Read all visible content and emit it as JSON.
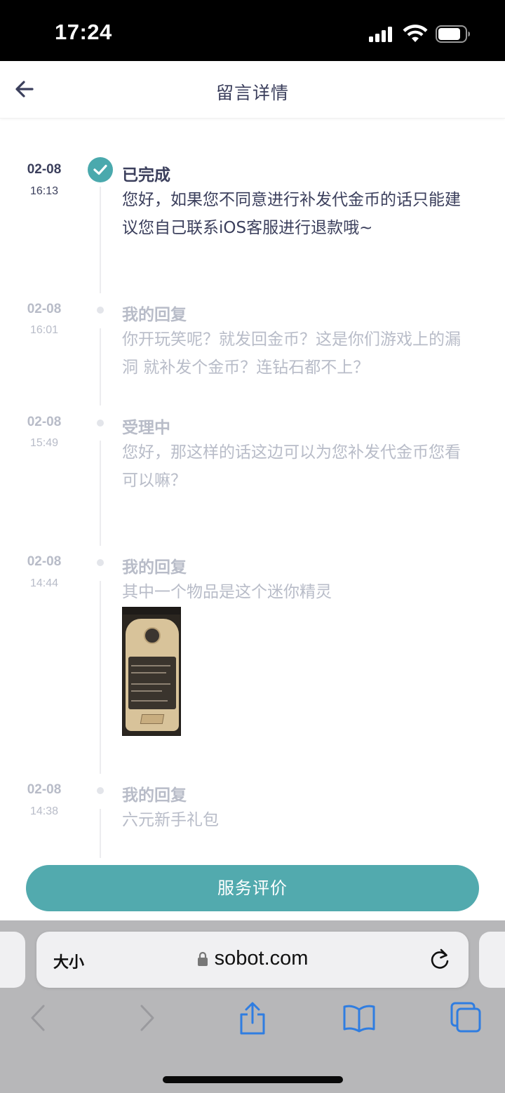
{
  "status_bar": {
    "time": "17:24"
  },
  "header": {
    "title": "留言详情",
    "back_icon": "arrow-left-icon"
  },
  "timeline": [
    {
      "date": "02-08",
      "time": "16:13",
      "title": "已完成",
      "text": "您好，如果您不同意进行补发代金币的话只能建议您自己联系iOS客服进行退款哦~",
      "status": "completed"
    },
    {
      "date": "02-08",
      "time": "16:01",
      "title": "我的回复",
      "text": "你开玩笑呢？就发回金币？这是你们游戏上的漏洞 就补发个金币？连钻石都不上？",
      "status": "history"
    },
    {
      "date": "02-08",
      "time": "15:49",
      "title": "受理中",
      "text": "您好，那这样的话这边可以为您补发代金币您看可以嘛？",
      "status": "history"
    },
    {
      "date": "02-08",
      "time": "14:44",
      "title": "我的回复",
      "text": "其中一个物品是这个迷你精灵",
      "status": "history",
      "has_image": true
    },
    {
      "date": "02-08",
      "time": "14:38",
      "title": "我的回复",
      "text": "六元新手礼包",
      "status": "history"
    }
  ],
  "action": {
    "rate_button": "服务评价"
  },
  "browser": {
    "text_size_label": "大小",
    "url": "sobot.com"
  },
  "colors": {
    "accent": "#52aaae",
    "title_text": "#3b3f5c",
    "muted_text": "#b8bcc8"
  }
}
